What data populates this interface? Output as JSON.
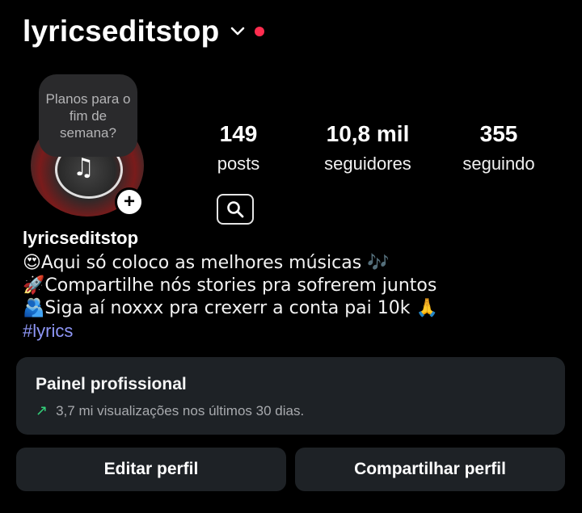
{
  "header": {
    "username": "lyricseditstop"
  },
  "profile": {
    "note_text": "Planos para o fim de semana?",
    "stats": [
      {
        "value": "149",
        "label": "posts"
      },
      {
        "value": "10,8 mil",
        "label": "seguidores"
      },
      {
        "value": "355",
        "label": "seguindo"
      }
    ]
  },
  "bio": {
    "name": "lyricseditstop",
    "lines": [
      "😍Aqui só coloco as melhores músicas 🎶",
      "🚀Compartilhe nós stories pra sofrerem juntos",
      "🫂Siga aí noxxx pra crexerr a conta pai 10k 🙏"
    ],
    "hashtag": "#lyrics"
  },
  "panel": {
    "title": "Painel profissional",
    "subtitle": "3,7 mi visualizações nos últimos 30 dias."
  },
  "buttons": {
    "edit_label": "Editar perfil",
    "share_label": "Compartilhar perfil"
  },
  "icons": {
    "dropdown": "chevron-down-icon",
    "notification": "red-dot",
    "search": "search-icon",
    "add_story": "plus-icon",
    "trend": "arrow-up-right-icon"
  },
  "colors": {
    "background": "#000000",
    "card": "#1e2226",
    "hashtag": "#8f97f7",
    "notification_dot": "#ff2d4f",
    "trend_arrow": "#33d17a"
  }
}
